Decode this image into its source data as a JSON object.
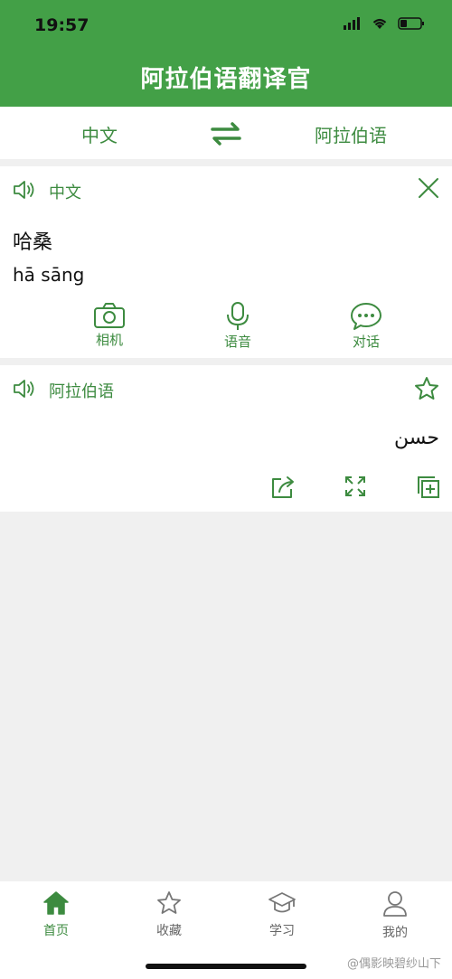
{
  "status_bar": {
    "time": "19:57"
  },
  "header": {
    "title": "阿拉伯语翻译官"
  },
  "lang_bar": {
    "source": "中文",
    "target": "阿拉伯语"
  },
  "source_card": {
    "language": "中文",
    "text": "哈桑",
    "pinyin": "hā sāng",
    "tools": [
      {
        "label": "相机",
        "icon": "camera-icon"
      },
      {
        "label": "语音",
        "icon": "microphone-icon"
      },
      {
        "label": "对话",
        "icon": "chat-icon"
      }
    ]
  },
  "result_card": {
    "language": "阿拉伯语",
    "text": "حسن",
    "actions": [
      "share-icon",
      "expand-icon",
      "copy-icon"
    ]
  },
  "tab_bar": {
    "items": [
      {
        "label": "首页",
        "icon": "home-icon",
        "active": true
      },
      {
        "label": "收藏",
        "icon": "star-icon",
        "active": false
      },
      {
        "label": "学习",
        "icon": "graduation-cap-icon",
        "active": false
      },
      {
        "label": "我的",
        "icon": "user-icon",
        "active": false
      }
    ]
  },
  "watermark": "@偶影映碧纱山下",
  "colors": {
    "accent": "#43a047",
    "accent_text": "#3d8b40",
    "background": "#f0f0f0"
  }
}
